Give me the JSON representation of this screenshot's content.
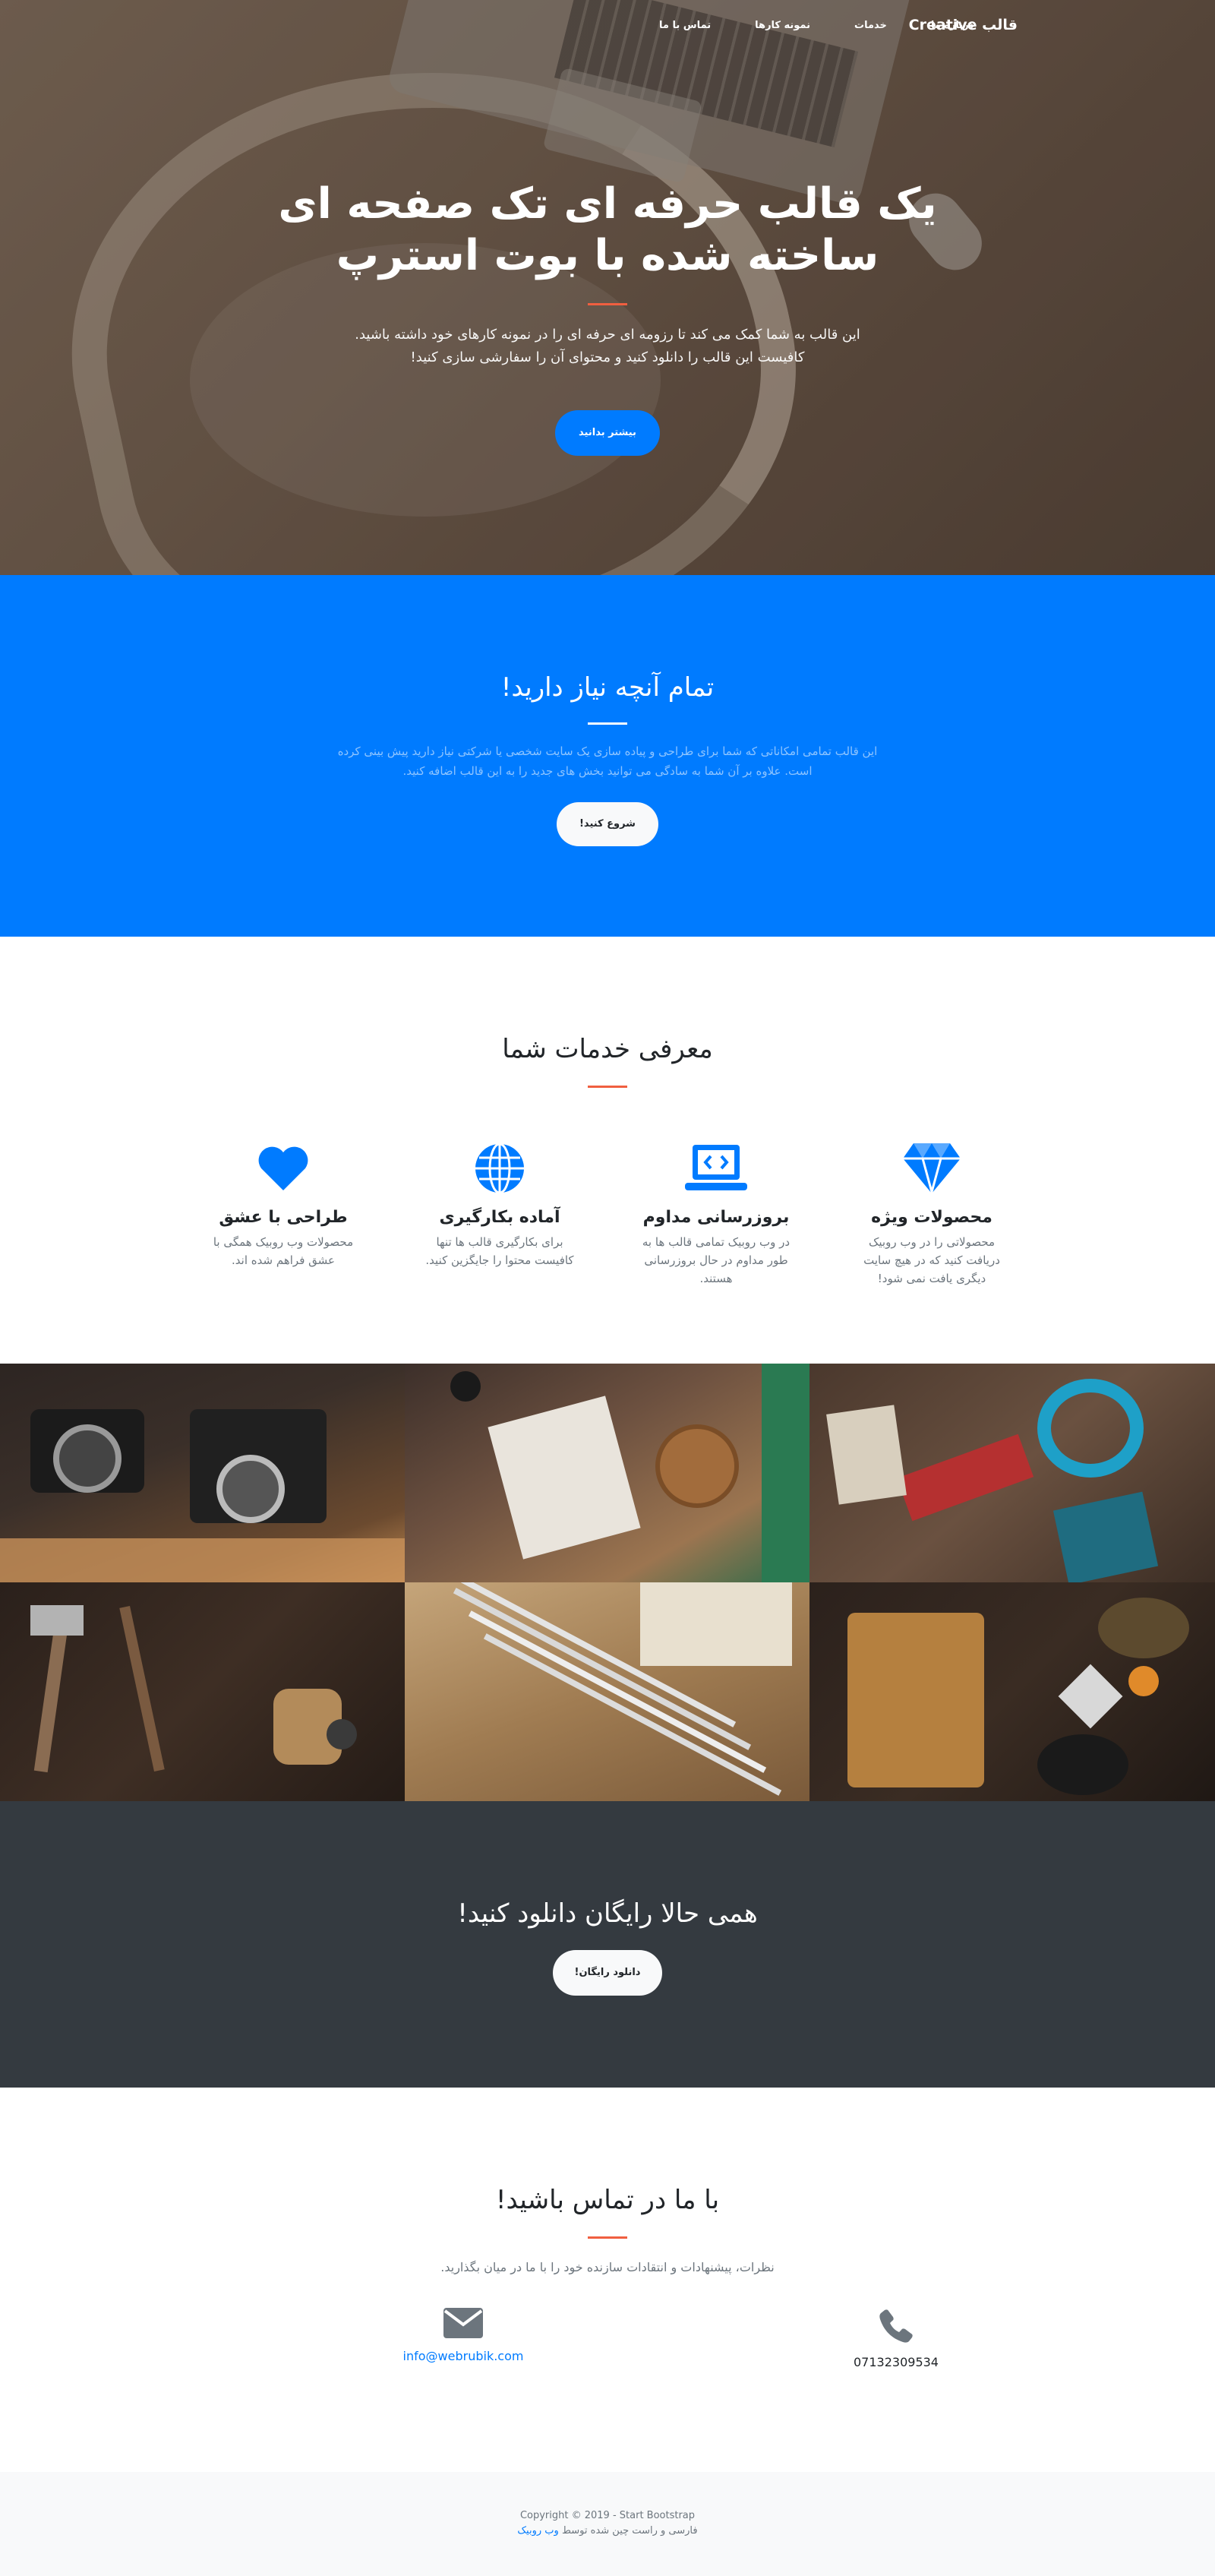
{
  "navbar": {
    "brand": "قالب Creative",
    "links": [
      "درباره ما",
      "خدمات",
      "نمونه کارها",
      "تماس با ما"
    ]
  },
  "hero": {
    "title": "یک قالب حرفه ای تک صفحه ای ساخته شده با بوت استرپ",
    "text": "این قالب به شما کمک می کند تا رزومه ای حرفه ای را در نمونه کارهای خود داشته باشید. کافیست این قالب را دانلود کنید و محتوای آن را سفارشی سازی کنید!",
    "button": "بیشتر بدانید"
  },
  "about": {
    "title": "تمام آنچه نیاز دارید!",
    "text": "این قالب تمامی امکاناتی که شما برای طراحی و پیاده سازی یک سایت شخصی یا شرکتی نیاز دارید پیش بینی کرده است. علاوه بر آن شما به سادگی می توانید بخش های جدید را به این قالب اضافه کنید.",
    "button": "شروع کنید!"
  },
  "services": {
    "title": "معرفی خدمات شما",
    "items": [
      {
        "icon": "gem-icon",
        "name": "محصولات ویژه",
        "desc": "محصولاتی را در وب روبیک دریافت کنید که در هیچ سایت دیگری یافت نمی شود!"
      },
      {
        "icon": "laptop-code-icon",
        "name": "بروزرسانی مداوم",
        "desc": "در وب روبیک تمامی قالب ها به طور مداوم در حال بروزرسانی هستند."
      },
      {
        "icon": "globe-icon",
        "name": "آماده بکارگیری",
        "desc": "برای بکارگیری قالب ها تنها کافیست محتوا را جایگزین کنید."
      },
      {
        "icon": "heart-icon",
        "name": "طراحی با عشق",
        "desc": "محصولات وب روبیک همگی با عشق فراهم شده اند."
      }
    ]
  },
  "cta": {
    "title": "همی حالا رایگان دانلود کنید!",
    "button": "دانلود رایگان!"
  },
  "contact": {
    "title": "با ما در تماس باشید!",
    "text": "نظرات، پیشنهادات و انتقادات سازنده خود را با ما در میان بگذارید.",
    "phone": "07132309534",
    "email": "info@webrubik.com"
  },
  "footer": {
    "copyright": "Copyright © 2019 - Start Bootstrap",
    "credit_prefix": "فارسی و راست چین شده توسط",
    "credit_link": "وب روبیک"
  },
  "colors": {
    "primary": "#007bff",
    "accent": "#f05f40",
    "dark": "#343a40",
    "light": "#f8f9fa"
  }
}
